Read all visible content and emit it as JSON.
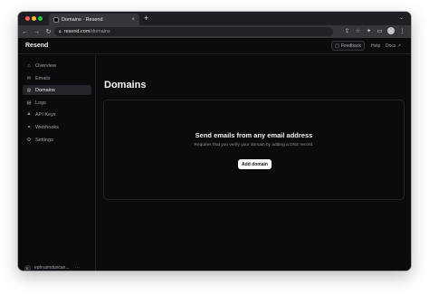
{
  "browser": {
    "tab_title": "Domains · Resend",
    "tab_close": "×",
    "new_tab": "+",
    "url_host": "resend.com",
    "url_path": "/domains"
  },
  "app": {
    "brand": "Resend",
    "header": {
      "feedback_label": "Feedback",
      "help_label": "Help",
      "docs_label": "Docs ↗"
    },
    "sidebar": {
      "items": [
        {
          "label": "Overview",
          "icon": "home-icon",
          "glyph": "⌂",
          "active": false
        },
        {
          "label": "Emails",
          "icon": "mail-icon",
          "glyph": "✉",
          "active": false
        },
        {
          "label": "Domains",
          "icon": "globe-icon",
          "glyph": "◎",
          "active": true
        },
        {
          "label": "Logs",
          "icon": "logs-icon",
          "glyph": "▤",
          "active": false
        },
        {
          "label": "API Keys",
          "icon": "lock-icon",
          "glyph": "🔒︎",
          "active": false
        },
        {
          "label": "Webhooks",
          "icon": "webhook-icon",
          "glyph": "⚭",
          "active": false
        },
        {
          "label": "Settings",
          "icon": "settings-icon",
          "glyph": "⚙",
          "active": false
        }
      ]
    },
    "user": {
      "initial": "E",
      "name": "ephraimduncan...",
      "more": "···"
    },
    "page": {
      "title": "Domains",
      "empty_state": {
        "title": "Send emails from any email address",
        "subtitle": "Requires that you verify your domain by adding a DNS record.",
        "button_label": "Add domain"
      }
    }
  },
  "colors": {
    "background": "#0b0b0e",
    "active_item": "#25252b",
    "primary_button": "#ffffff"
  }
}
